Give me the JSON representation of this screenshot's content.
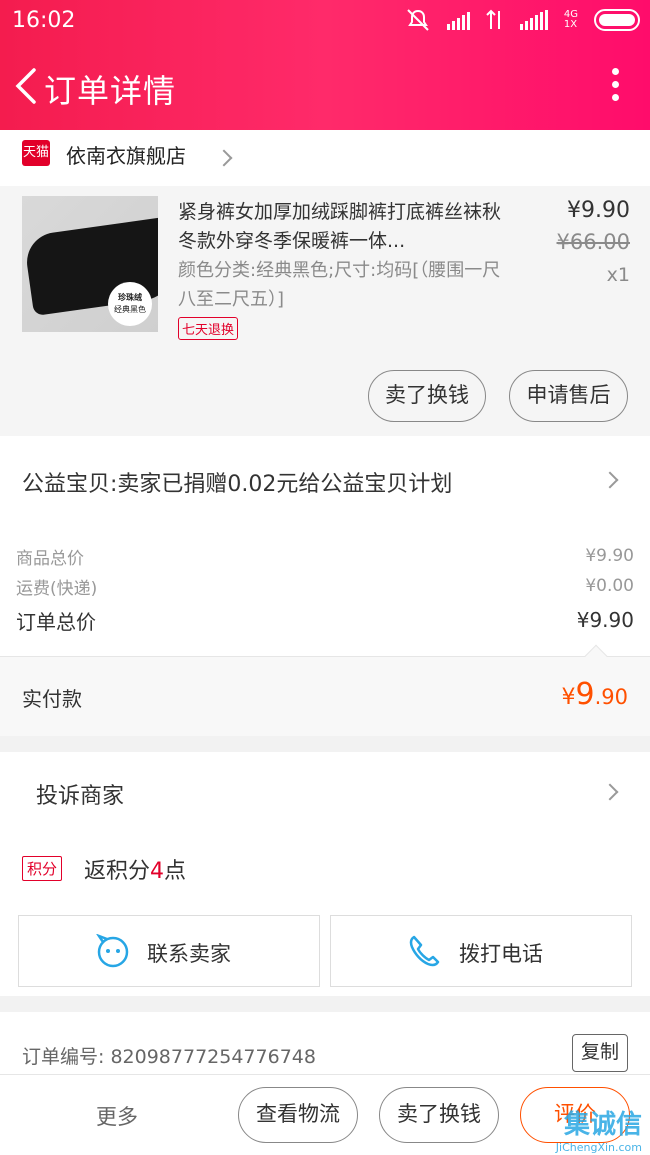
{
  "status_bar": {
    "time": "16:02",
    "net_top": "4G",
    "net_bottom": "1X"
  },
  "header": {
    "title": "订单详情"
  },
  "store": {
    "badge": "天猫",
    "name": "依南衣旗舰店"
  },
  "product": {
    "title": "紧身裤女加厚加绒踩脚裤打底裤丝袜秋冬款外穿冬季保暖裤一体...",
    "sku": "颜色分类:经典黑色;尺寸:均码[（腰围一尺八至二尺五）]",
    "tag": "七天退换",
    "price": "¥9.90",
    "original_price": "¥66.00",
    "quantity": "x1",
    "thumb_badge_line1": "珍珠绒",
    "thumb_badge_line2": "经典黑色",
    "buttons": {
      "sell": "卖了换钱",
      "after_sale": "申请售后"
    }
  },
  "charity": {
    "text": "公益宝贝:卖家已捐赠0.02元给公益宝贝计划"
  },
  "summary": {
    "rows": [
      {
        "label": "商品总价",
        "value": "¥9.90"
      },
      {
        "label": "运费(快递)",
        "value": "¥0.00"
      },
      {
        "label": "订单总价",
        "value": "¥9.90"
      }
    ]
  },
  "paid": {
    "label": "实付款",
    "currency": "¥",
    "integer": "9",
    "decimal": ".90"
  },
  "actions": {
    "complain": "投诉商家",
    "points_tag": "积分",
    "points_prefix": "返积分",
    "points_value": "4",
    "points_suffix": "点",
    "contact_seller": "联系卖家",
    "call": "拨打电话"
  },
  "order": {
    "number_label": "订单编号:",
    "number": "82098777254776748",
    "copy": "复制"
  },
  "bottom_bar": {
    "more": "更多",
    "logistics": "查看物流",
    "sell": "卖了换钱",
    "review": "评价"
  },
  "watermark": {
    "brand": "集诚信",
    "url": "JiChengXin.com"
  },
  "colors": {
    "header_start": "#f41c4e",
    "header_end": "#ff0c6b",
    "accent_red": "#e2002a",
    "accent_orange": "#ff5000"
  }
}
